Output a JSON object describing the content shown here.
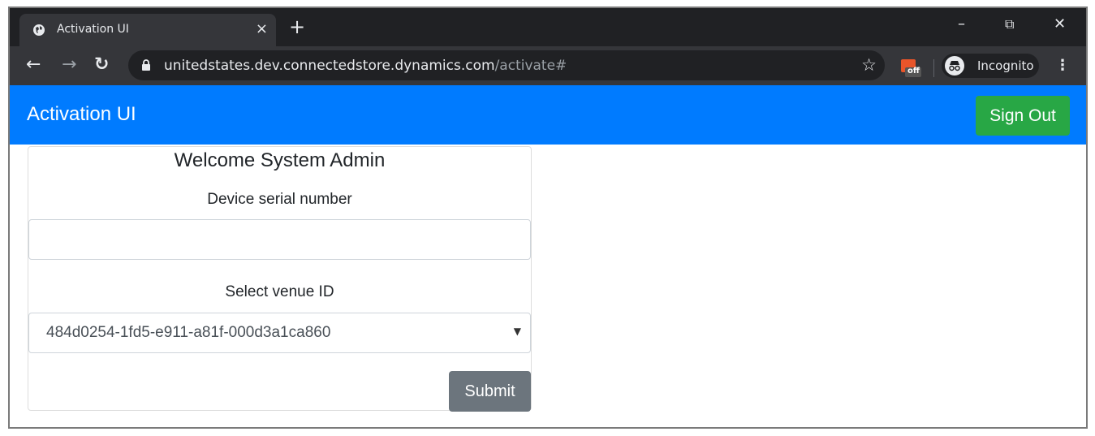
{
  "browser": {
    "tab_title": "Activation UI",
    "tab_close": "×",
    "new_tab": "+",
    "url_host": "unitedstates.dev.connectedstore.dynamics.com",
    "url_path": "/activate#",
    "extension_badge": "off",
    "profile_label": "Incognito",
    "window_controls": {
      "minimize": "–",
      "restore": "⧉",
      "close": "✕"
    },
    "nav": {
      "back": "←",
      "forward": "→",
      "reload": "↻",
      "star": "☆",
      "menu": "⋮"
    }
  },
  "app": {
    "brand": "Activation UI",
    "sign_out_label": "Sign Out",
    "accent_color": "#007bff",
    "sign_out_color": "#28a745"
  },
  "form": {
    "heading": "Welcome System Admin",
    "serial_label": "Device serial number",
    "serial_value": "",
    "venue_label": "Select venue ID",
    "venue_selected": "484d0254-1fd5-e911-a81f-000d3a1ca860",
    "submit_label": "Submit"
  }
}
